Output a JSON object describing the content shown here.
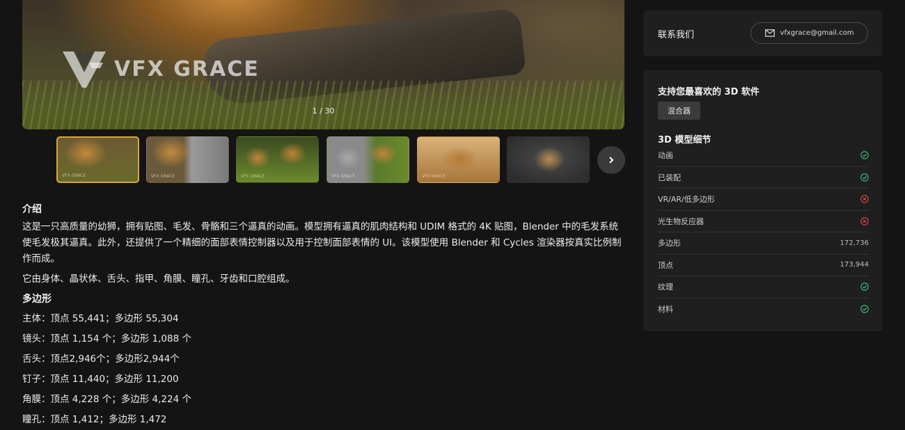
{
  "gallery": {
    "counter": "1 / 30",
    "watermark": "VFX GRACE",
    "thumb_label": "VFX GRACE"
  },
  "description": {
    "heading": "介绍",
    "paragraph1": "这是一只高质量的幼狮，拥有贴图、毛发、骨骼和三个逼真的动画。模型拥有逼真的肌肉结构和 UDIM 格式的 4K 贴图，Blender 中的毛发系统使毛发极其逼真。此外，还提供了一个精细的面部表情控制器以及用于控制面部表情的 UI。该模型使用 Blender 和 Cycles 渲染器按真实比例制作而成。",
    "paragraph2": "它由身体、晶状体、舌头、指甲、角膜、瞳孔、牙齿和口腔组成。",
    "poly_heading": "多边形",
    "poly_lines": [
      "主体：顶点 55,441；多边形 55,304",
      "镜头：顶点 1,154 个；多边形 1,088 个",
      "舌头：顶点2,946个；多边形2,944个",
      "钉子：顶点 11,440；多边形 11,200",
      "角膜：顶点 4,228 个；多边形 4,224 个",
      "瞳孔：顶点 1,412；多边形 1,472"
    ]
  },
  "contact": {
    "title": "联系我们",
    "email": "vfxgrace@gmail.com"
  },
  "software": {
    "title": "支持您最喜欢的 3D 软件",
    "chip": "混合器"
  },
  "details": {
    "title": "3D 模型细节",
    "rows": [
      {
        "label": "动画",
        "status": "yes"
      },
      {
        "label": "已装配",
        "status": "yes"
      },
      {
        "label": "VR/AR/低多边形",
        "status": "no"
      },
      {
        "label": "光生物反应器",
        "status": "no"
      },
      {
        "label": "多边形",
        "value": "172,736"
      },
      {
        "label": "顶点",
        "value": "173,944"
      },
      {
        "label": "纹理",
        "status": "yes"
      },
      {
        "label": "材料",
        "status": "yes"
      }
    ]
  },
  "colors": {
    "background": "#141414",
    "card": "#1f1f1f",
    "accent_active_thumb": "#d9a53a",
    "check": "#3fbf7f",
    "cross": "#e04848"
  },
  "icons": [
    "vfx-grace-logo-icon",
    "chevron-right-icon",
    "mail-icon",
    "check-circle-icon",
    "x-circle-icon"
  ]
}
